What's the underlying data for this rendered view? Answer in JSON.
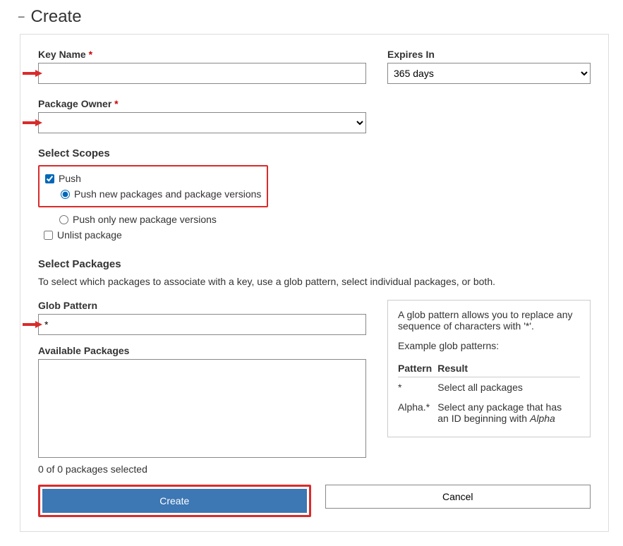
{
  "header": {
    "title": "Create"
  },
  "form": {
    "key_name_label": "Key Name",
    "expires_label": "Expires In",
    "expires_value": "365 days",
    "package_owner_label": "Package Owner"
  },
  "scopes": {
    "heading": "Select Scopes",
    "push_label": "Push",
    "push_new_label": "Push new packages and package versions",
    "push_only_label": "Push only new package versions",
    "unlist_label": "Unlist package"
  },
  "packages": {
    "heading": "Select Packages",
    "desc": "To select which packages to associate with a key, use a glob pattern, select individual packages, or both.",
    "glob_label": "Glob Pattern",
    "glob_value": "*",
    "available_label": "Available Packages",
    "status": "0 of 0 packages selected"
  },
  "help": {
    "intro": "A glob pattern allows you to replace any sequence of characters with '*'.",
    "examples_label": "Example glob patterns:",
    "col_pattern": "Pattern",
    "col_result": "Result",
    "rows": [
      {
        "pattern": "*",
        "result_prefix": "Select all packages",
        "result_suffix": ""
      },
      {
        "pattern": "Alpha.*",
        "result_prefix": "Select any package that has an ID beginning with ",
        "result_suffix": "Alpha"
      }
    ]
  },
  "buttons": {
    "create": "Create",
    "cancel": "Cancel"
  }
}
